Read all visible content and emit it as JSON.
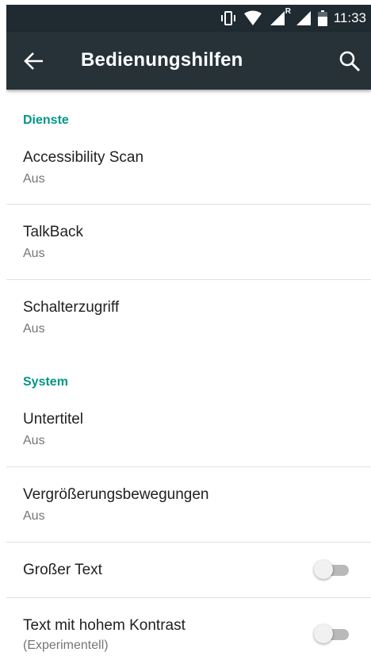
{
  "status_bar": {
    "time": "11:33",
    "roaming_indicator": "R",
    "icons": [
      "vibrate-icon",
      "wifi-icon",
      "signal-roaming-icon",
      "signal-icon",
      "battery-icon"
    ]
  },
  "toolbar": {
    "title": "Bedienungshilfen",
    "back_icon": "arrow-back-icon",
    "search_icon": "search-icon"
  },
  "sections": {
    "services": {
      "header": "Dienste",
      "items": [
        {
          "title": "Accessibility Scan",
          "summary": "Aus"
        },
        {
          "title": "TalkBack",
          "summary": "Aus"
        },
        {
          "title": "Schalterzugriff",
          "summary": "Aus"
        }
      ]
    },
    "system": {
      "header": "System",
      "items": [
        {
          "title": "Untertitel",
          "summary": "Aus"
        },
        {
          "title": "Vergrößerungsbewegungen",
          "summary": "Aus"
        },
        {
          "title": "Großer Text",
          "toggle_on": false
        },
        {
          "title": "Text mit hohem Kontrast",
          "summary": "(Experimentell)",
          "toggle_on": false
        }
      ]
    }
  },
  "colors": {
    "status_bar": "#1f2a31",
    "toolbar": "#263238",
    "accent": "#009688",
    "switch_off_track": "#b9b9b9"
  }
}
